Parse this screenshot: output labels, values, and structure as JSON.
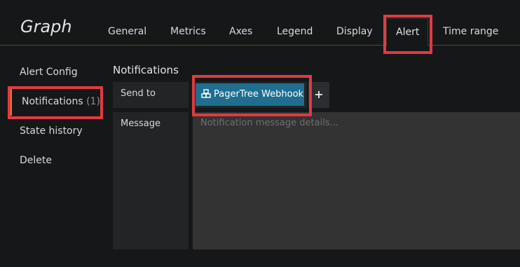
{
  "header": {
    "title": "Graph",
    "tabs": [
      {
        "label": "General"
      },
      {
        "label": "Metrics"
      },
      {
        "label": "Axes"
      },
      {
        "label": "Legend"
      },
      {
        "label": "Display"
      },
      {
        "label": "Alert",
        "active": true
      },
      {
        "label": "Time range"
      }
    ]
  },
  "sidebar": {
    "items": [
      {
        "label": "Alert Config"
      },
      {
        "label": "Notifications",
        "count": "(1)",
        "active": true
      },
      {
        "label": "State history"
      },
      {
        "label": "Delete"
      }
    ]
  },
  "notifications": {
    "title": "Notifications",
    "send_to_label": "Send to",
    "channel": "PagerTree Webhook",
    "add_label": "+",
    "message_label": "Message",
    "message_placeholder": "Notification message details..."
  },
  "colors": {
    "background": "#161719",
    "accent": "#eb7b18",
    "chip": "#1f6e8f",
    "highlight": "#e03a43"
  }
}
